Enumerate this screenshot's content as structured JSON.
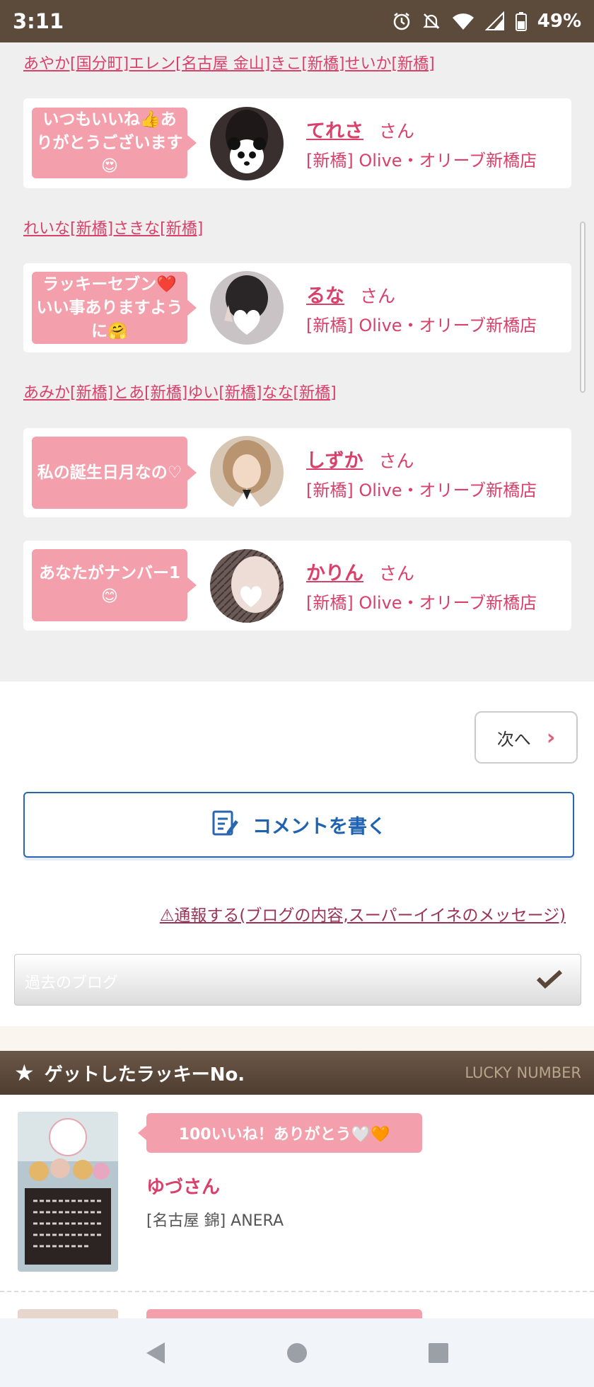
{
  "status_bar": {
    "time": "3:11",
    "battery": "49%"
  },
  "senders": [
    "あやか[国分町]エレン[名古屋 金山]きこ[新橋]せいか[新橋]",
    "れいな[新橋]さきな[新橋]",
    "あみか[新橋]とあ[新橋]ゆい[新橋]なな[新橋]"
  ],
  "cards": [
    {
      "message": "いつもいいね👍ありがとうございます😍",
      "name": "てれさ",
      "honorific": "さん",
      "shop": "[新橋] Olive・オリーブ新橋店"
    },
    {
      "message": "ラッキーセブン❤️いい事ありますように🤗",
      "name": "るな",
      "honorific": "さん",
      "shop": "[新橋] Olive・オリーブ新橋店"
    },
    {
      "message": "私の誕生日月なの♡",
      "name": "しずか",
      "honorific": "さん",
      "shop": "[新橋] Olive・オリーブ新橋店"
    },
    {
      "message": "あなたがナンバー1😊",
      "name": "かりん",
      "honorific": "さん",
      "shop": "[新橋] Olive・オリーブ新橋店"
    }
  ],
  "pagination": {
    "next_label": "次へ"
  },
  "comment_button": {
    "label": "コメントを書く"
  },
  "report_link": "⚠通報する(ブログの内容,スーパーイイネのメッセージ)",
  "past_blog_select": {
    "label": "過去のブログ"
  },
  "lucky_section": {
    "title": "ゲットしたラッキーNo.",
    "subtitle": "LUCKY NUMBER",
    "items": [
      {
        "message": "100いいね！ありがとう🤍🧡",
        "name": "ゆづさん",
        "shop": "[名古屋 錦] ANERA"
      }
    ]
  },
  "colors": {
    "accent_pink": "#d9406a",
    "bubble_pink": "#f4a0ac",
    "header_brown": "#5c4a3b",
    "comment_blue": "#1f62b0"
  },
  "icons": [
    "alarm-icon",
    "bell-off-icon",
    "wifi-icon",
    "signal-icon",
    "battery-icon",
    "chevron-right-icon",
    "edit-note-icon",
    "checkmark-icon",
    "star-icon",
    "back-icon",
    "home-icon",
    "recents-icon"
  ]
}
